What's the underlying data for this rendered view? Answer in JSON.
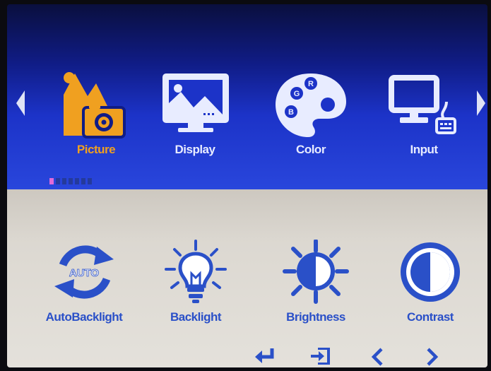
{
  "menu": {
    "items": [
      {
        "label": "Picture",
        "icon": "picture-icon",
        "active": true
      },
      {
        "label": "Display",
        "icon": "display-icon",
        "active": false
      },
      {
        "label": "Color",
        "icon": "color-palette-icon",
        "active": false
      },
      {
        "label": "Input",
        "icon": "input-icon",
        "active": false
      }
    ],
    "page_index": 1,
    "page_count": 7
  },
  "palette": {
    "labels": [
      "R",
      "G",
      "B"
    ]
  },
  "auto_icon_text": "AUTO",
  "submenu": {
    "items": [
      {
        "label": "AutoBacklight",
        "icon": "auto-backlight-icon"
      },
      {
        "label": "Backlight",
        "icon": "lightbulb-icon"
      },
      {
        "label": "Brightness",
        "icon": "sun-icon"
      },
      {
        "label": "Contrast",
        "icon": "contrast-icon"
      }
    ]
  },
  "nav": {
    "buttons": [
      "enter-icon",
      "exit-icon",
      "chevron-left-icon",
      "chevron-right-icon"
    ]
  },
  "colors": {
    "active": "#f0a020",
    "menu_text": "#e8ecff",
    "submenu_blue": "#2a50c8",
    "page_dot_active": "#e06ad8"
  }
}
